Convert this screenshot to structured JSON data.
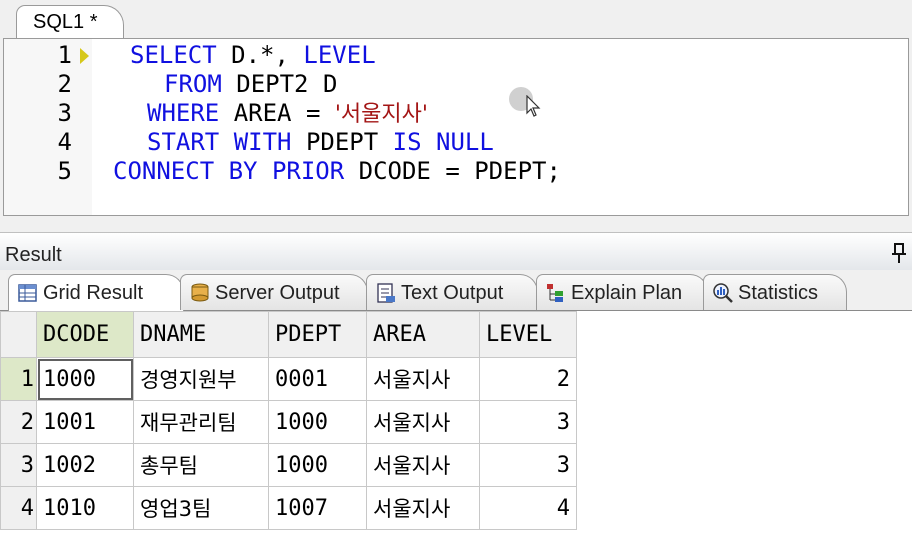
{
  "editor_tab": {
    "label": "SQL1 *"
  },
  "editor": {
    "lines": [
      {
        "no": "1",
        "parts": [
          [
            "kw",
            "SELECT"
          ],
          [
            "t",
            " D.*, "
          ],
          [
            "kw",
            "LEVEL"
          ]
        ]
      },
      {
        "no": "2",
        "parts": [
          [
            "kw",
            "FROM"
          ],
          [
            "t",
            " DEPT2 D"
          ]
        ]
      },
      {
        "no": "3",
        "parts": [
          [
            "kw",
            "WHERE"
          ],
          [
            "t",
            " AREA = "
          ],
          [
            "str",
            "'서울지사'"
          ]
        ]
      },
      {
        "no": "4",
        "parts": [
          [
            "kw",
            "START WITH"
          ],
          [
            "t",
            " PDEPT "
          ],
          [
            "kw",
            "IS NULL"
          ]
        ]
      },
      {
        "no": "5",
        "parts": [
          [
            "kw",
            "CONNECT BY PRIOR"
          ],
          [
            "t",
            " DCODE = PDEPT;"
          ]
        ]
      }
    ]
  },
  "result": {
    "title": "Result",
    "tabs": [
      {
        "label": "Grid Result",
        "icon": "grid-result-icon",
        "active": true
      },
      {
        "label": "Server Output",
        "icon": "server-output-icon",
        "active": false
      },
      {
        "label": "Text Output",
        "icon": "text-output-icon",
        "active": false
      },
      {
        "label": "Explain Plan",
        "icon": "explain-plan-icon",
        "active": false
      },
      {
        "label": "Statistics",
        "icon": "statistics-icon",
        "active": false
      }
    ],
    "columns": [
      "DCODE",
      "DNAME",
      "PDEPT",
      "AREA",
      "LEVEL"
    ],
    "rows": [
      {
        "rn": "1",
        "cells": [
          "1000",
          "경영지원부",
          "0001",
          "서울지사",
          "2"
        ]
      },
      {
        "rn": "2",
        "cells": [
          "1001",
          "재무관리팀",
          "1000",
          "서울지사",
          "3"
        ]
      },
      {
        "rn": "3",
        "cells": [
          "1002",
          "총무팀",
          "1000",
          "서울지사",
          "3"
        ]
      },
      {
        "rn": "4",
        "cells": [
          "1010",
          "영업3팀",
          "1007",
          "서울지사",
          "4"
        ]
      }
    ]
  },
  "colors": {
    "keyword": "#1010e0",
    "string": "#a31515",
    "selection": "#dde8c8"
  }
}
